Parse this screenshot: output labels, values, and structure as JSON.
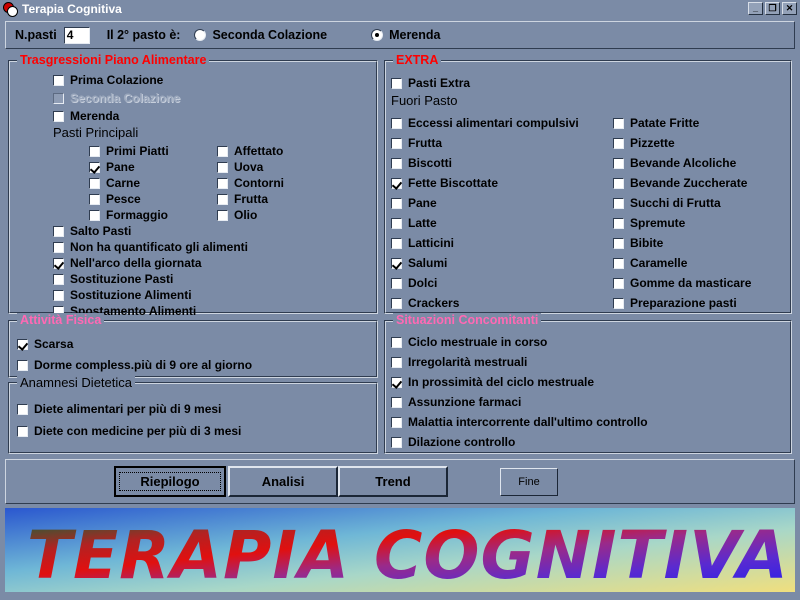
{
  "window": {
    "title": "Terapia Cognitiva",
    "icon": "app-balls-icon",
    "minimize": "_",
    "maximize": "❐",
    "close": "✕"
  },
  "topbar": {
    "npasti_label": "N.pasti",
    "npasti_value": "4",
    "question_label": "Il 2° pasto è:",
    "options": [
      {
        "label": "Seconda Colazione",
        "selected": false
      },
      {
        "label": "Merenda",
        "selected": true
      }
    ]
  },
  "groups": {
    "trasgressioni": {
      "title": "Trasgressioni Piano Alimentare",
      "title_color": "#ff0000",
      "items": [
        {
          "label": "Prima Colazione",
          "checked": false,
          "disabled": false
        },
        {
          "label": "Seconda Colazione",
          "checked": false,
          "disabled": true
        },
        {
          "label": "Merenda",
          "checked": false,
          "disabled": false
        }
      ],
      "subheading": "Pasti Principali",
      "col1": [
        {
          "label": "Primi Piatti",
          "checked": false
        },
        {
          "label": "Pane",
          "checked": true
        },
        {
          "label": "Carne",
          "checked": false
        },
        {
          "label": "Pesce",
          "checked": false
        },
        {
          "label": "Formaggio",
          "checked": false
        }
      ],
      "col2": [
        {
          "label": "Affettato",
          "checked": false
        },
        {
          "label": "Uova",
          "checked": false
        },
        {
          "label": "Contorni",
          "checked": false
        },
        {
          "label": "Frutta",
          "checked": false
        },
        {
          "label": "Olio",
          "checked": false
        }
      ],
      "tail": [
        {
          "label": "Salto Pasti",
          "checked": false
        },
        {
          "label": "Non ha quantificato gli alimenti",
          "checked": false
        },
        {
          "label": "Nell'arco della giornata",
          "checked": true
        },
        {
          "label": "Sostituzione Pasti",
          "checked": false
        },
        {
          "label": "Sostituzione Alimenti",
          "checked": false
        },
        {
          "label": "Spostamento Alimenti",
          "checked": false
        }
      ]
    },
    "extra": {
      "title": "EXTRA",
      "title_color": "#ff0000",
      "top": [
        {
          "label": "Pasti Extra",
          "checked": false
        }
      ],
      "subheading": "Fuori Pasto",
      "col1": [
        {
          "label": "Eccessi alimentari compulsivi",
          "checked": false
        },
        {
          "label": "Frutta",
          "checked": false
        },
        {
          "label": "Biscotti",
          "checked": false
        },
        {
          "label": "Fette Biscottate",
          "checked": true
        },
        {
          "label": "Pane",
          "checked": false
        },
        {
          "label": "Latte",
          "checked": false
        },
        {
          "label": "Latticini",
          "checked": false
        },
        {
          "label": "Salumi",
          "checked": true
        },
        {
          "label": "Dolci",
          "checked": false
        },
        {
          "label": "Crackers",
          "checked": false
        }
      ],
      "col2": [
        {
          "label": "Patate Fritte",
          "checked": false
        },
        {
          "label": "Pizzette",
          "checked": false
        },
        {
          "label": "Bevande Alcoliche",
          "checked": false
        },
        {
          "label": "Bevande Zuccherate",
          "checked": false
        },
        {
          "label": "Succhi di Frutta",
          "checked": false
        },
        {
          "label": "Spremute",
          "checked": false
        },
        {
          "label": "Bibite",
          "checked": false
        },
        {
          "label": "Caramelle",
          "checked": false
        },
        {
          "label": "Gomme da masticare",
          "checked": false
        },
        {
          "label": "Preparazione pasti",
          "checked": false
        }
      ]
    },
    "attivita": {
      "title": "Attività Fisica",
      "title_color": "#ff69b4",
      "items": [
        {
          "label": "Scarsa",
          "checked": true
        },
        {
          "label": "Dorme compless.più di 9 ore al giorno",
          "checked": false
        }
      ]
    },
    "anamnesi": {
      "title": "Anamnesi Dietetica",
      "title_color": "#000000",
      "items": [
        {
          "label": "Diete alimentari per più di 9 mesi",
          "checked": false
        },
        {
          "label": "Diete con medicine per più di 3 mesi",
          "checked": false
        }
      ]
    },
    "situazioni": {
      "title": "Situazioni Concomitanti",
      "title_color": "#ff69b4",
      "items": [
        {
          "label": "Ciclo mestruale in corso",
          "checked": false
        },
        {
          "label": "Irregolarità mestruali",
          "checked": false
        },
        {
          "label": "In prossimità del ciclo mestruale",
          "checked": true
        },
        {
          "label": "Assunzione farmaci",
          "checked": false
        },
        {
          "label": "Malattia intercorrente dall'ultimo controllo",
          "checked": false
        },
        {
          "label": "Dilazione controllo",
          "checked": false
        }
      ]
    }
  },
  "buttons": [
    {
      "label": "Riepilogo",
      "focused": true
    },
    {
      "label": "Analisi",
      "focused": false
    },
    {
      "label": "Trend",
      "focused": false
    },
    {
      "label": "Fine",
      "focused": false
    }
  ],
  "banner": {
    "text": "TERAPIA COGNITIVA",
    "bg_start": "#2a57cf",
    "bg_mid": "#8ecfd8",
    "bg_end": "#efe089",
    "text_top": "#0b6b3a",
    "text_left": "#e01010",
    "text_right": "#2020ee"
  }
}
